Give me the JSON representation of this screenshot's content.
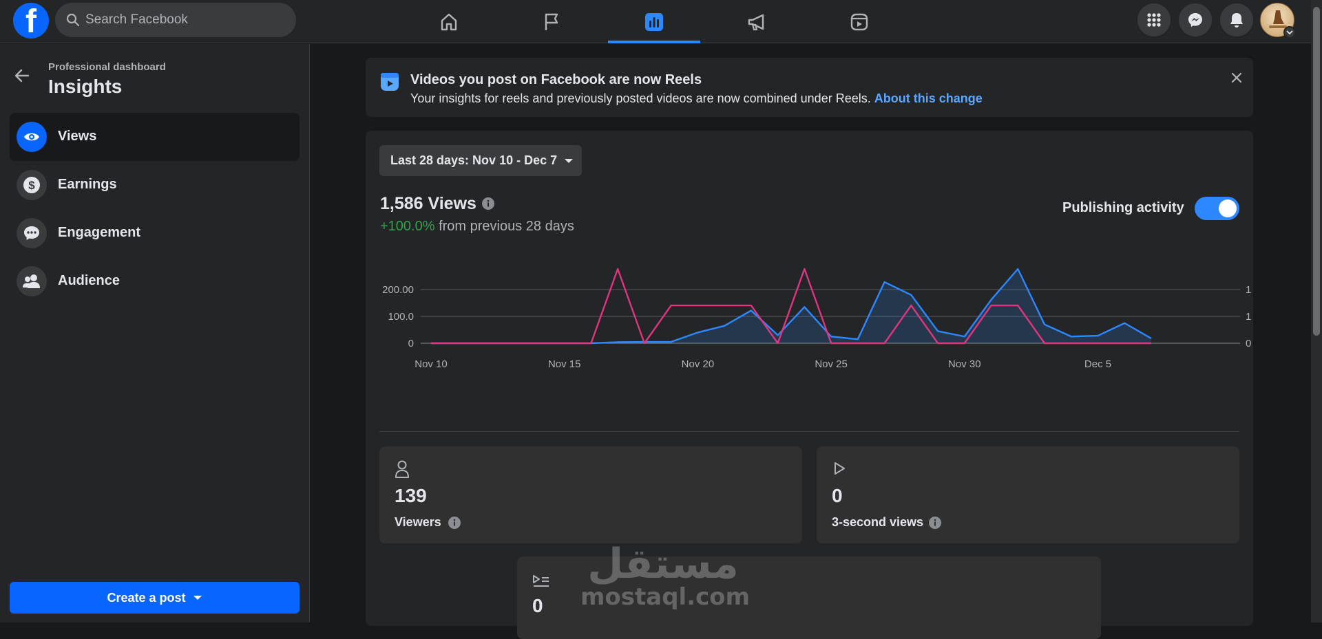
{
  "topbar": {
    "logo": "f",
    "search_placeholder": "Search Facebook",
    "nav_tabs": [
      "home-icon",
      "flag-icon",
      "insights-chart-icon",
      "megaphone-icon",
      "reels-icon"
    ],
    "active_tab": "insights-chart-icon",
    "right_buttons": [
      "menu-grid-icon",
      "messenger-icon",
      "notifications-bell-icon"
    ]
  },
  "sidebar": {
    "subtitle": "Professional dashboard",
    "title": "Insights",
    "items": [
      {
        "label": "Views",
        "icon": "eye-icon",
        "active": true
      },
      {
        "label": "Earnings",
        "icon": "dollar-icon",
        "active": false
      },
      {
        "label": "Engagement",
        "icon": "chat-icon",
        "active": false
      },
      {
        "label": "Audience",
        "icon": "people-icon",
        "active": false
      }
    ],
    "create_post": "Create a post"
  },
  "banner": {
    "title": "Videos you post on Facebook are now Reels",
    "body": "Your insights for reels and previously posted videos are now combined under Reels.",
    "link": "About this change"
  },
  "insights": {
    "date_range": "Last 28 days: Nov 10 - Dec 7",
    "views_total": "1,586 Views",
    "change_pct": "+100.0%",
    "change_text": "from previous 28 days",
    "publishing_activity_label": "Publishing activity",
    "publishing_activity_on": true
  },
  "chart_data": {
    "type": "line",
    "x": [
      "Nov 10",
      "Nov 11",
      "Nov 12",
      "Nov 13",
      "Nov 14",
      "Nov 15",
      "Nov 16",
      "Nov 17",
      "Nov 18",
      "Nov 19",
      "Nov 20",
      "Nov 21",
      "Nov 22",
      "Nov 23",
      "Nov 24",
      "Nov 25",
      "Nov 26",
      "Nov 27",
      "Nov 28",
      "Nov 29",
      "Nov 30",
      "Dec 1",
      "Dec 2",
      "Dec 3",
      "Dec 4",
      "Dec 5",
      "Dec 6",
      "Dec 7"
    ],
    "x_tick_labels": [
      "Nov 10",
      "Nov 15",
      "Nov 20",
      "Nov 25",
      "Nov 30",
      "Dec 5"
    ],
    "series": [
      {
        "axis": "left",
        "color": "#2d88ff",
        "fill": true,
        "values": [
          0,
          0,
          0,
          0,
          0,
          0,
          0,
          4,
          5,
          5,
          40,
          65,
          122,
          30,
          135,
          25,
          15,
          228,
          180,
          45,
          25,
          162,
          277,
          70,
          25,
          28,
          75,
          18
        ]
      },
      {
        "axis": "right",
        "color": "#e0357f",
        "fill": false,
        "values": [
          0,
          0,
          0,
          0,
          0,
          0,
          0,
          2.75,
          0,
          1.4,
          1.4,
          1.4,
          1.4,
          0,
          2.75,
          0,
          0,
          0,
          1.4,
          0,
          0,
          1.4,
          1.4,
          0,
          0,
          0,
          0,
          0
        ]
      }
    ],
    "left_axis": {
      "ticks": [
        "0",
        "100.0",
        "200.00"
      ],
      "tick_values": [
        0,
        100,
        200
      ],
      "ylim": [
        0,
        277
      ]
    },
    "right_axis": {
      "ticks": [
        "0",
        "1",
        "1"
      ],
      "tick_values": [
        0,
        1,
        2
      ],
      "ylim": [
        0,
        2.75
      ]
    },
    "grid": true
  },
  "stats": [
    {
      "icon": "person-icon",
      "value": "139",
      "label": "Viewers"
    },
    {
      "icon": "play-icon",
      "value": "0",
      "label": "3-second views"
    },
    {
      "icon": "playlist-icon",
      "value": "0",
      "label": ""
    }
  ],
  "watermark": {
    "arabic": "مستقل",
    "latin": "mostaql.com"
  }
}
